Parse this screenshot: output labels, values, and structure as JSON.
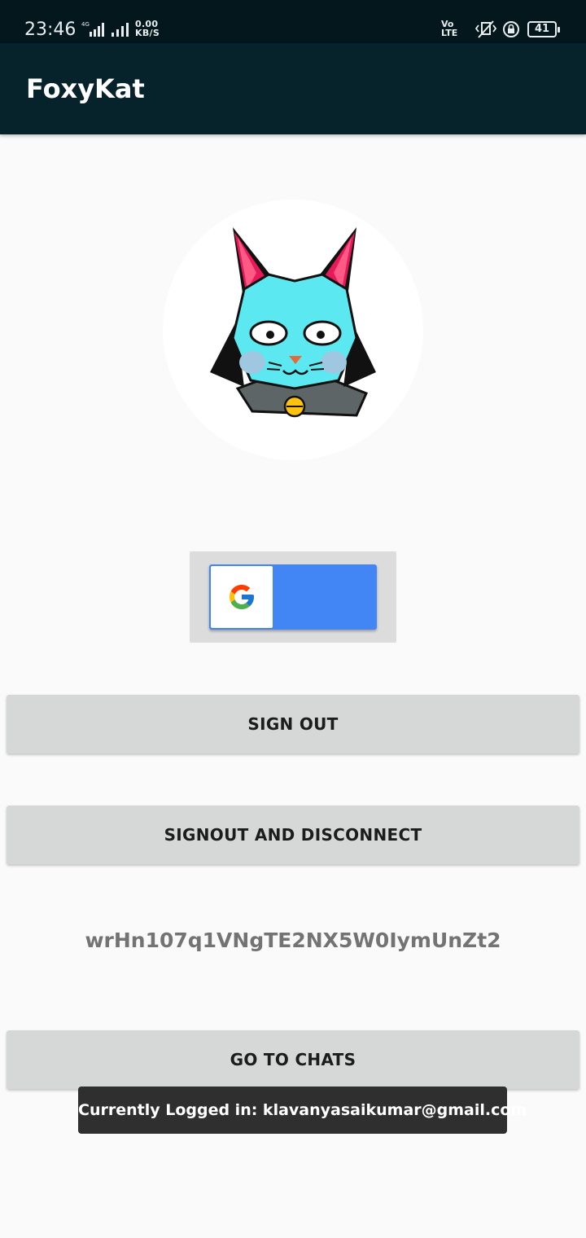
{
  "status_bar": {
    "time": "23:46",
    "network": "4G",
    "speed_value": "0.00",
    "speed_unit": "KB/S",
    "volte_top": "Vo",
    "volte_bottom": "LTE",
    "battery": "41"
  },
  "app_bar": {
    "title": "FoxyKat"
  },
  "avatar": {
    "icon": "cat-avatar-icon"
  },
  "google_signin": {
    "icon": "google-logo-icon",
    "color": "#4285f4"
  },
  "buttons": {
    "sign_out": "SIGN OUT",
    "signout_disconnect": "SIGNOUT AND DISCONNECT",
    "go_to_chats": "GO TO CHATS"
  },
  "user_id": "wrHn107q1VNgTE2NX5W0IymUnZt2",
  "toast": "Currently Logged in: klavanyasaikumar@gmail.com",
  "colors": {
    "app_bar": "#06222a",
    "status_bar": "#03171c",
    "button_bg": "#d6d7d7",
    "toast_bg": "#2f2f2f"
  }
}
